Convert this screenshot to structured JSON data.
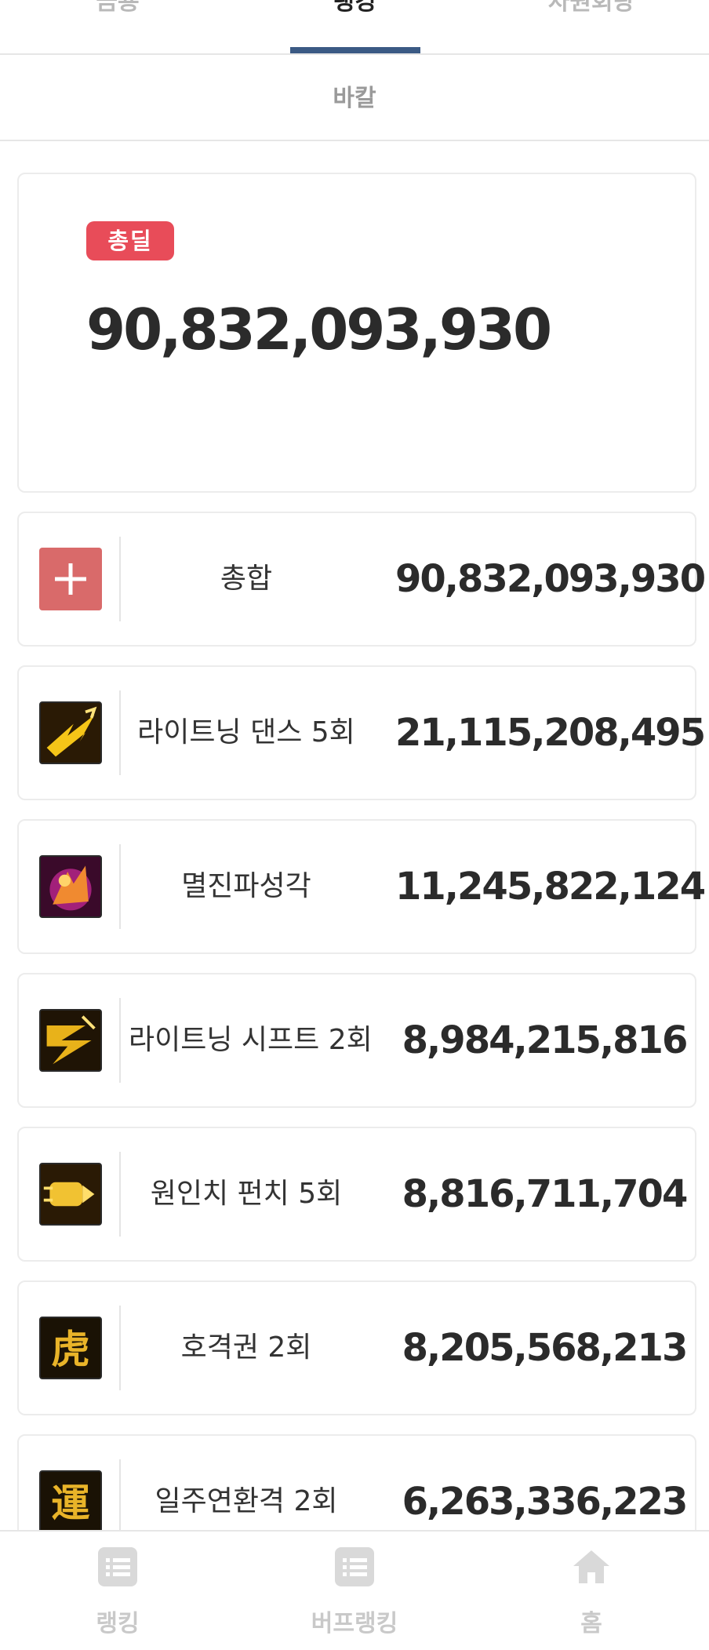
{
  "tabs": [
    {
      "label": "금룡"
    },
    {
      "label": "랭킹"
    },
    {
      "label": "차원회랑"
    }
  ],
  "subtab": {
    "label": "바칼"
  },
  "total": {
    "badge": "총딜",
    "value": "90,832,093,930"
  },
  "rows": [
    {
      "icon": "plus-icon",
      "name": "총합",
      "value": "90,832,093,930"
    },
    {
      "icon": "lightning-dance-icon",
      "name": "라이트닝 댄스 5회",
      "value": "21,115,208,495"
    },
    {
      "icon": "myeoljin-icon",
      "name": "멸진파성각",
      "value": "11,245,822,124"
    },
    {
      "icon": "lightning-shift-icon",
      "name": "라이트닝 시프트 2회",
      "value": "8,984,215,816"
    },
    {
      "icon": "one-inch-punch-icon",
      "name": "원인치 펀치 5회",
      "value": "8,816,711,704"
    },
    {
      "icon": "tiger-fist-icon",
      "name": "호격권 2회",
      "value": "8,205,568,213"
    },
    {
      "icon": "ilju-combo-icon",
      "name": "일주연환격 2회",
      "value": "6,263,336,223"
    }
  ],
  "bottom_nav": [
    {
      "label": "랭킹",
      "icon": "list-icon"
    },
    {
      "label": "버프랭킹",
      "icon": "list-icon"
    },
    {
      "label": "홈",
      "icon": "home-icon"
    }
  ],
  "colors": {
    "accent": "#3b5a84",
    "badge": "#e84c59",
    "plus": "#d96a6a"
  }
}
